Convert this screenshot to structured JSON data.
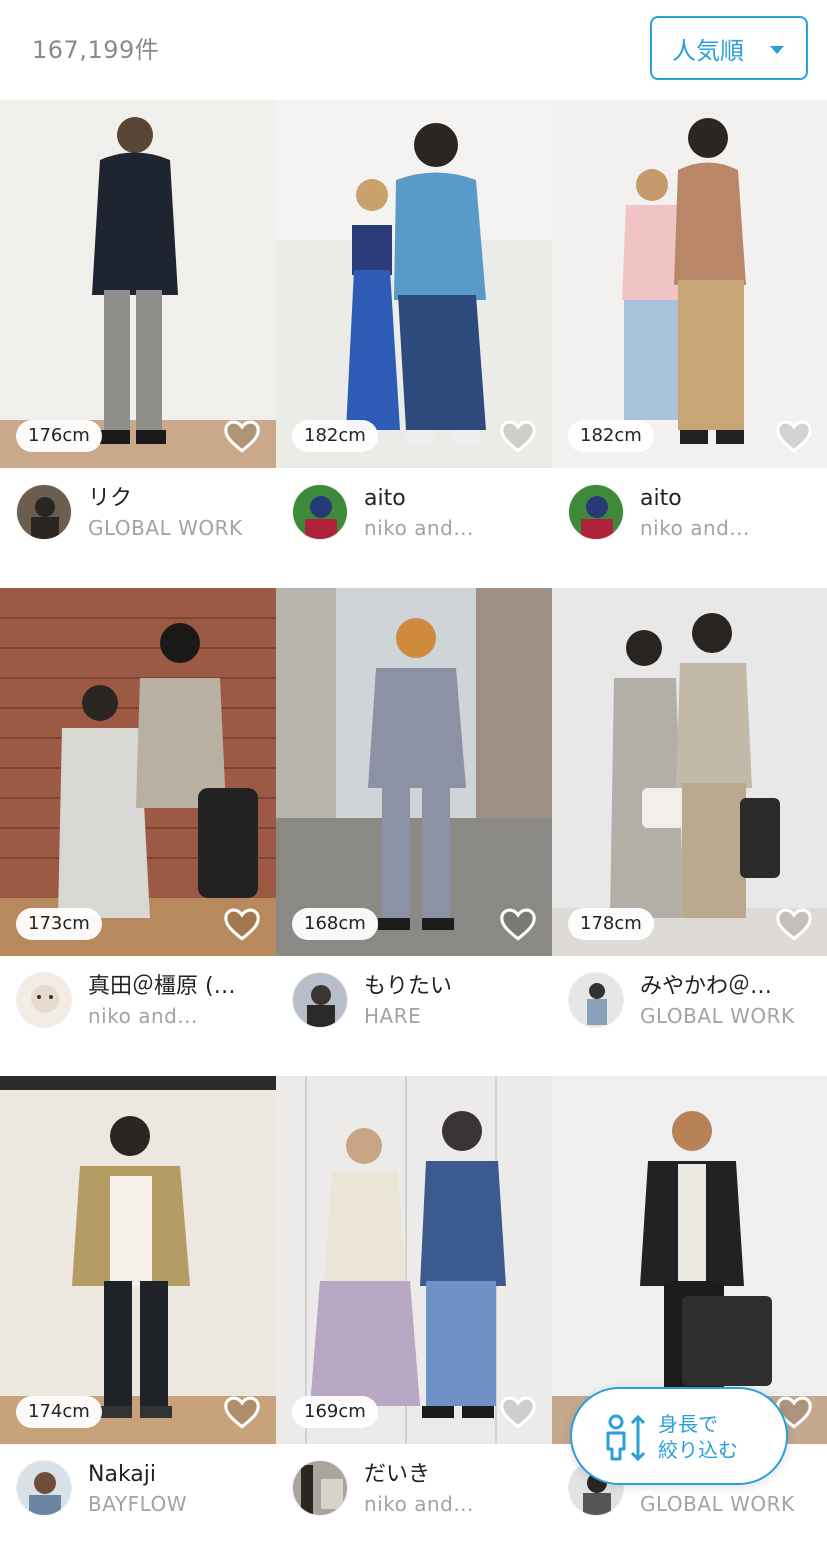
{
  "header": {
    "result_count": "167,199件",
    "sort_label": "人気順"
  },
  "colors": {
    "accent": "#2a9fd8",
    "muted_text": "#8a8a8a",
    "brand_text": "#a3a3a3"
  },
  "cards": [
    {
      "height": "176cm",
      "name": "リク",
      "brand": "GLOBAL WORK"
    },
    {
      "height": "182cm",
      "name": "aito",
      "brand": "niko and..."
    },
    {
      "height": "182cm",
      "name": "aito",
      "brand": "niko and..."
    },
    {
      "height": "173cm",
      "name": "真田＠橿原 (…",
      "brand": "niko and..."
    },
    {
      "height": "168cm",
      "name": "もりたい",
      "brand": "HARE"
    },
    {
      "height": "178cm",
      "name": "みやかわ＠…",
      "brand": "GLOBAL WORK"
    },
    {
      "height": "174cm",
      "name": "Nakaji",
      "brand": "BAYFLOW"
    },
    {
      "height": "169cm",
      "name": "だいき",
      "brand": "niko and..."
    },
    {
      "height": "",
      "name": "",
      "brand": "GLOBAL WORK"
    }
  ],
  "height_filter": {
    "line1": "身長で",
    "line2": "絞り込む",
    "icon": "person-height-icon"
  }
}
